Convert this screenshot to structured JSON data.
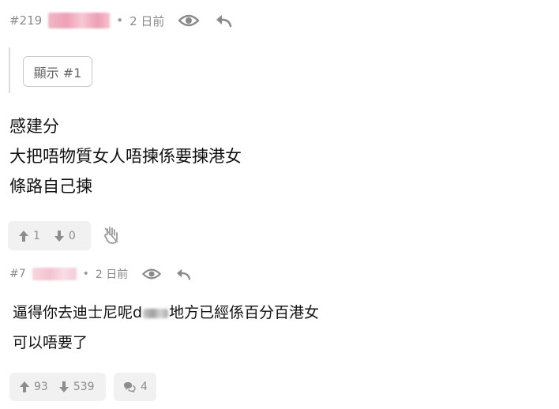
{
  "post1": {
    "number": "#219",
    "time": "2 日前",
    "quote_button": "顯示 #1",
    "lines": [
      "感建分",
      "大把唔物質女人唔揀係要揀港女",
      "條路自己揀"
    ],
    "upvotes": "1",
    "downvotes": "0"
  },
  "post2": {
    "number": "#7",
    "time": "2 日前",
    "line1_before": "逼得你去迪士尼呢d",
    "line1_after": "地方已經係百分百港女",
    "line2": "可以唔要了",
    "upvotes": "93",
    "downvotes": "539",
    "replies": "4"
  },
  "separator": "•"
}
